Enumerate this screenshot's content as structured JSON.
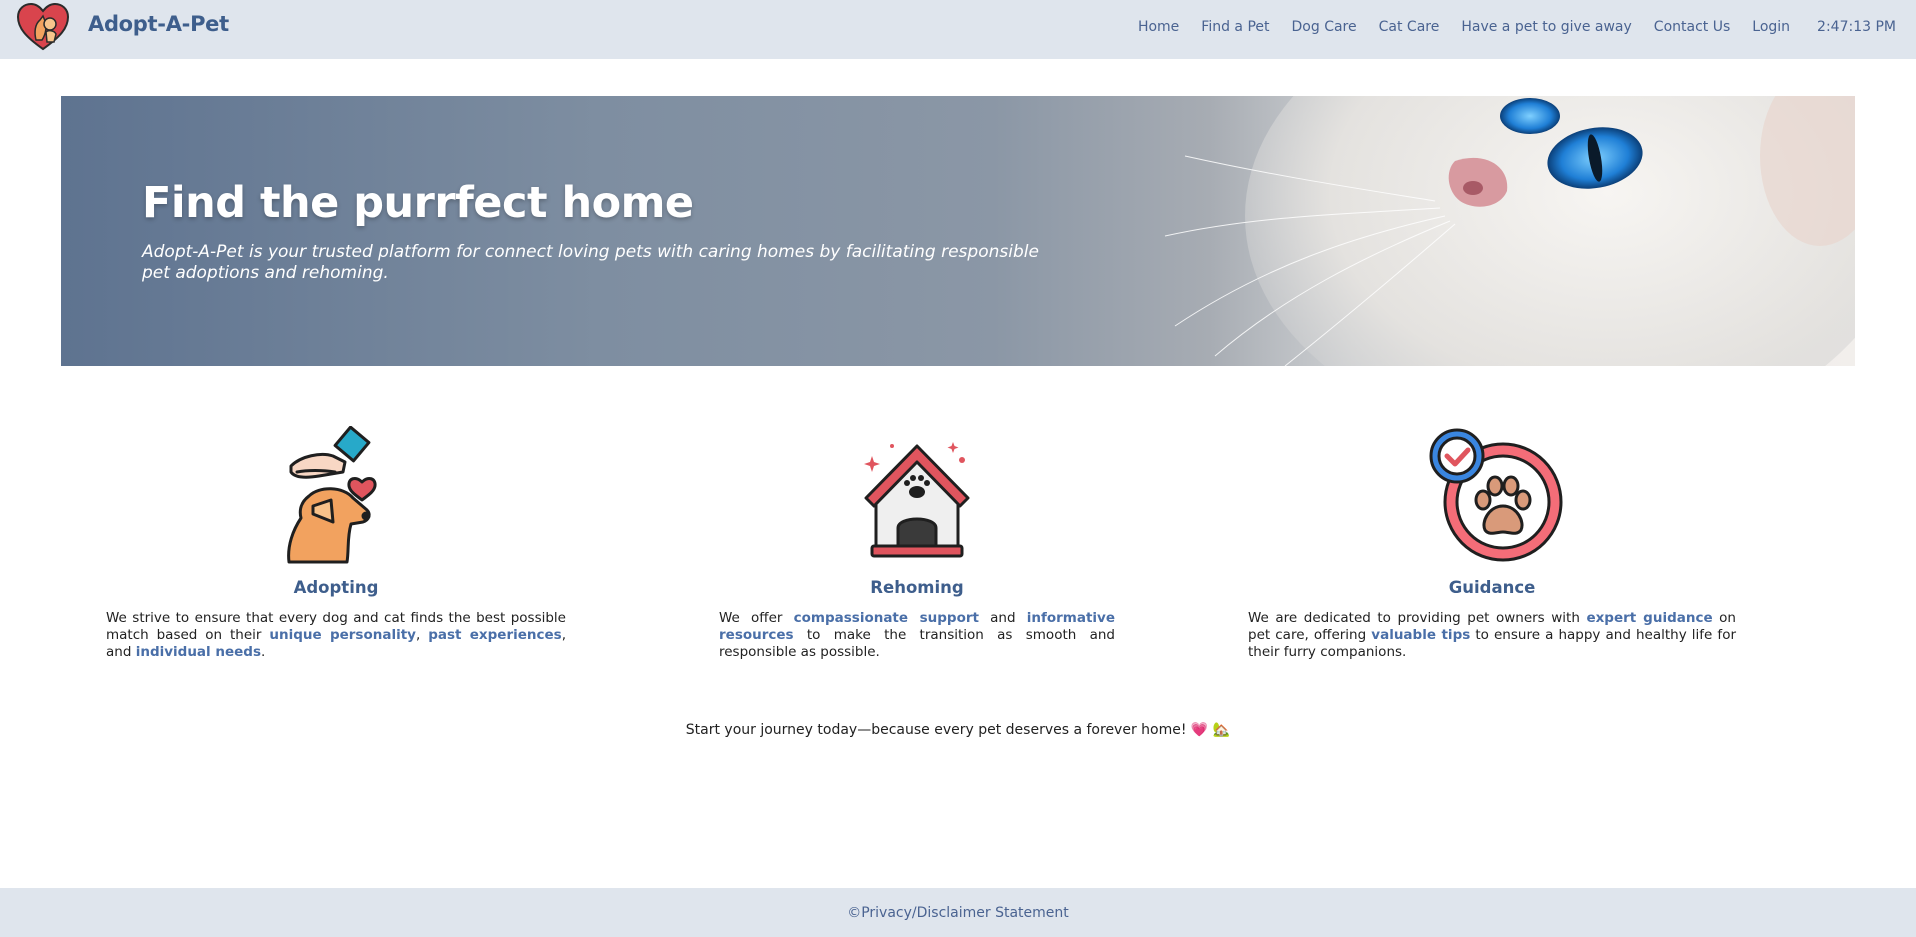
{
  "brand": {
    "name": "Adopt-A-Pet"
  },
  "nav": {
    "items": [
      {
        "label": "Home"
      },
      {
        "label": "Find a Pet"
      },
      {
        "label": "Dog Care"
      },
      {
        "label": "Cat Care"
      },
      {
        "label": "Have a pet to give away"
      },
      {
        "label": "Contact Us"
      },
      {
        "label": "Login"
      }
    ],
    "clock": "2:47:13 PM"
  },
  "hero": {
    "title": "Find the purrfect home",
    "subtitle": "Adopt-A-Pet is your trusted platform for connect loving pets with caring homes by facilitating responsible pet adoptions and rehoming."
  },
  "features": [
    {
      "title": "Adopting",
      "icon": "dog-hand-icon",
      "text": {
        "t1": "We strive to ensure that every dog and cat finds the best possible match based on their ",
        "h1": "unique personality",
        "t2": ", ",
        "h2": "past experiences",
        "t3": ", and ",
        "h3": "individual needs",
        "t4": "."
      }
    },
    {
      "title": "Rehoming",
      "icon": "dog-house-icon",
      "text": {
        "t1": "We offer ",
        "h1": "compassionate support",
        "t2": " and ",
        "h2": "informative resources",
        "t3": " to make the transition as smooth and responsible as possible."
      }
    },
    {
      "title": "Guidance",
      "icon": "paw-check-icon",
      "text": {
        "t1": "We are dedicated to providing pet owners with ",
        "h1": "expert guidance",
        "t2": " on pet care, offering ",
        "h2": "valuable tips",
        "t3": " to ensure a happy and healthy life for their furry companions."
      }
    }
  ],
  "journey": "Start your journey today—because every pet deserves a forever home! 💗 🏡",
  "footer": {
    "link": "©Privacy/Disclaimer Statement"
  },
  "colors": {
    "nav_bg": "#dfe5ed",
    "brand": "#3e5e8c",
    "link": "#4a6391",
    "highlight": "#4a6fa8",
    "accent_red": "#e0555e",
    "accent_teal": "#27a9c9",
    "accent_orange": "#f2a25f"
  }
}
